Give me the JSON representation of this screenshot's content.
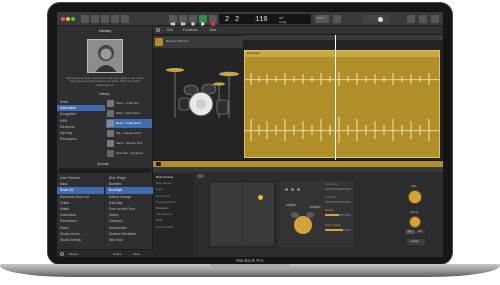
{
  "device": {
    "brand": "MacBook Pro"
  },
  "toolbar": {
    "position": "2",
    "beat": "2",
    "tempo": "110",
    "key": "Cmaj",
    "signature": "4/4",
    "count_in": "1234"
  },
  "library": {
    "title": "Library",
    "artist_caption": "Although seemingly most serious with long nights in the studio, Alex's sets are pretty relaxed and loose. Maria is a pretty classically-on.",
    "genres": [
      "Rock",
      "Alternative",
      "Songwriter",
      "R&B",
      "Electronic",
      "Hip Hop",
      "Percussion"
    ],
    "selected_genre": "Alternative",
    "drummers": [
      "Aiden - Indie Pop",
      "Nikki - Indie Disco",
      "Beam - Indie Rock",
      "Zak - Garage Rock",
      "Maya - Modern 80's",
      "Somnath - Synthpop"
    ],
    "selected_drummer": "Beam - Indie Rock",
    "sounds_header": "Sounds",
    "sounds_left": [
      "User Patches",
      "Bass",
      "Drum Kit",
      "Electronic Drum Kit",
      "Guitar",
      "Mallet",
      "Orchestral",
      "Percussion",
      "Piano",
      "Studio Horns",
      "Studio Strings"
    ],
    "sounds_right": [
      "Blue Ridge",
      "Bluebird",
      "Brooklyn",
      "Detroit Garage",
      "East Bay",
      "Four on the Floor",
      "Heavy",
      "Liverpool",
      "Manchester",
      "Motown Revisited",
      "Neo Soul"
    ],
    "selected_sound_left": "Drum Kit",
    "selected_sound_right": "Brooklyn",
    "footer": [
      "Revert",
      "Delete",
      "Save..."
    ]
  },
  "tracks": {
    "menu": [
      "Edit",
      "Functions",
      "View"
    ],
    "track_name": "Brooklyn (Beam)",
    "region_name": "Drummer"
  },
  "editor": {
    "left_items": [
      "Beat Presets",
      "Blue Motion",
      "Funk",
      "Chord Ave",
      "Property Field",
      "Boogaloo",
      "The Factory",
      "Beat",
      "Gimme Slide"
    ],
    "selected_item": "Gimme Slide",
    "follow_label": "Follow",
    "params": [
      "Percussion",
      "Cymbals",
      "Hi-Hat",
      "Kick & Snare"
    ],
    "fill_label": "Fills",
    "swing_label": "Swing",
    "details_label": "Details",
    "swing_opts": [
      "8th",
      "16th"
    ]
  },
  "colors": {
    "accent": "#b08f2a",
    "selection": "#3f6db0",
    "play": "#39c25a",
    "record": "#e23b30"
  }
}
